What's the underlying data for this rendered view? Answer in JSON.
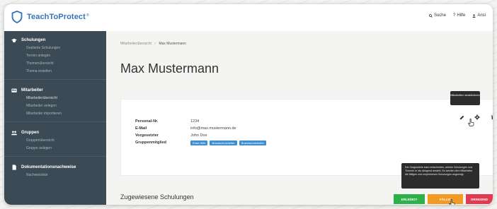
{
  "app": {
    "logo_text": "TeachToProtect",
    "logo_mark": "®"
  },
  "topnav": [
    {
      "label": "Suche",
      "icon": "search-icon"
    },
    {
      "label": "Hilfe",
      "icon": "question-icon"
    },
    {
      "label": "Ansi",
      "icon": "user-icon"
    }
  ],
  "sidebar": {
    "sections": [
      {
        "label": "Schulungen",
        "icon": "graduation-cap-icon",
        "items": [
          "Geplante Schulungen",
          "Termin anlegen",
          "Themenübersicht",
          "Thema erstellen"
        ]
      },
      {
        "label": "Mitarbeiter",
        "icon": "id-card-icon",
        "items": [
          "Mitarbeiterübersicht",
          "Mitarbeiter anlegen",
          "Mitarbeiter importieren"
        ]
      },
      {
        "label": "Gruppen",
        "icon": "group-icon",
        "items": [
          "Gruppenübersicht",
          "Gruppe anlegen"
        ]
      },
      {
        "label": "Dokumentationsnachweise",
        "icon": "document-icon",
        "items": [
          "Nachweisliste"
        ]
      }
    ]
  },
  "breadcrumb": {
    "parent": "Mitarbeiterübersicht",
    "separator": "›",
    "current": "Max Mustermann"
  },
  "page_title": "Max Mustermann",
  "profile": {
    "fields": [
      {
        "label": "Personal-Nr.",
        "value": "1234"
      },
      {
        "label": "E-Mail",
        "value": "info@max.mustermann.de"
      },
      {
        "label": "Vorgesetzter",
        "value": "John Doe"
      }
    ],
    "groups_label": "Gruppenmitglied",
    "groups": [
      "Erste Hilfe",
      "Brandschutzhelfer",
      "Brandschutzhelfer"
    ]
  },
  "tooltips": {
    "action_tooltip": "Mitarbeiter deaktivieren",
    "status_tooltip": "Der Vorgesetzte kann entscheiden, welche Schulungen und Themen er als dringend ansieht. Es werden dem Mitarbeiter die fälligen und empfohlenen Schulungen angezeigt."
  },
  "assigned": {
    "title": "Zugewiesene Schulungen",
    "buttons": {
      "green": "ERLEDIGT",
      "orange": "FÄLLIG",
      "red": "DRINGEND"
    }
  },
  "colors": {
    "brand": "#3573b9",
    "sidebar": "#3b4a55",
    "tag": "#3d8fd4",
    "green": "#2db14b",
    "orange": "#f39a23",
    "red": "#e23a53"
  }
}
